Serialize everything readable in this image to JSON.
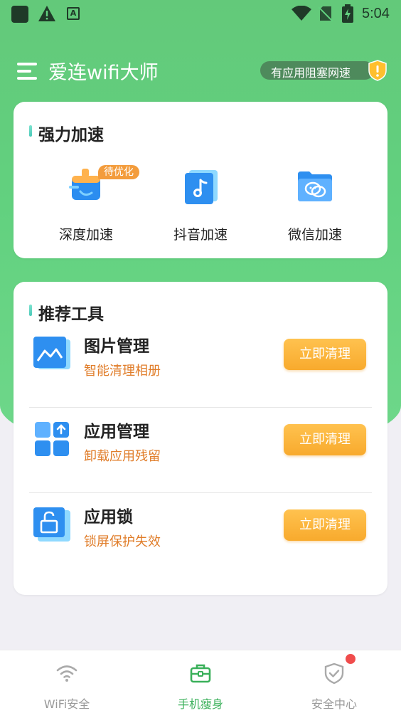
{
  "status_bar": {
    "time": "5:04",
    "icons": [
      "app-icon",
      "warning-icon",
      "accessibility-a-icon",
      "wifi-icon",
      "no-sim-icon",
      "battery-charging-icon"
    ]
  },
  "header": {
    "title": "爱连wifi大师",
    "alert_text": "有应用阻塞网速",
    "alert_icon": "warning-shield-icon"
  },
  "accelerate": {
    "title": "强力加速",
    "items": [
      {
        "label": "深度加速",
        "badge": "待优化",
        "icon": "broom-clean-icon"
      },
      {
        "label": "抖音加速",
        "icon": "tiktok-music-icon"
      },
      {
        "label": "微信加速",
        "icon": "wechat-folder-icon"
      }
    ]
  },
  "tools": {
    "title": "推荐工具",
    "items": [
      {
        "name": "图片管理",
        "desc": "智能清理相册",
        "button": "立即清理",
        "icon": "image-gallery-icon"
      },
      {
        "name": "应用管理",
        "desc": "卸载应用残留",
        "button": "立即清理",
        "icon": "app-grid-upload-icon"
      },
      {
        "name": "应用锁",
        "desc": "锁屏保护失效",
        "button": "立即清理",
        "icon": "app-lock-icon"
      }
    ]
  },
  "bottom_nav": {
    "active_index": 1,
    "items": [
      {
        "label": "WiFi安全",
        "icon": "wifi-icon"
      },
      {
        "label": "手机瘦身",
        "icon": "toolbox-icon"
      },
      {
        "label": "安全中心",
        "icon": "shield-check-icon",
        "has_dot": true
      }
    ]
  },
  "colors": {
    "brand_green": "#62d17f",
    "active_nav": "#3ab05a",
    "orange_button": "#f8aa2d",
    "orange_text": "#e07d2a",
    "notification_dot": "#f04c4c"
  }
}
